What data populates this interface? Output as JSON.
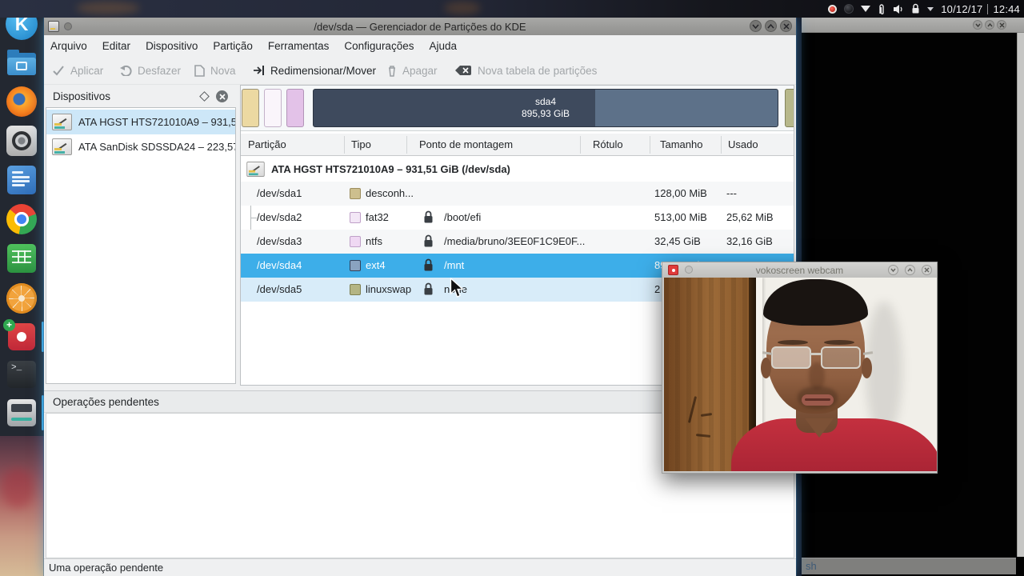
{
  "taskbar": {
    "clock_date": "10/12/17",
    "clock_time": "12:44",
    "tray_icons": [
      "record-icon",
      "dark-sphere-icon",
      "network-triangle-icon",
      "clipboard-paperclip-icon",
      "volume-icon",
      "lock-icon",
      "expand-caret-icon"
    ]
  },
  "dock": {
    "items": [
      {
        "icon": "kde-launcher-icon"
      },
      {
        "icon": "file-manager-icon"
      },
      {
        "icon": "firefox-icon"
      },
      {
        "icon": "media-wheel-icon"
      },
      {
        "icon": "word-processor-icon"
      },
      {
        "icon": "chrome-icon"
      },
      {
        "icon": "spreadsheet-icon"
      },
      {
        "icon": "orange-music-icon"
      },
      {
        "icon": "vokoscreen-icon"
      },
      {
        "icon": "terminal-icon"
      },
      {
        "icon": "partition-manager-icon"
      },
      {
        "icon": "desktop-folder-icon"
      }
    ],
    "kde_letter": "K",
    "terminal_glyph": ">_"
  },
  "background_window": {
    "status_text": "sh"
  },
  "partition_manager": {
    "titlebar": {
      "title": "/dev/sda — Gerenciador de Partições do KDE"
    },
    "menu": {
      "items": [
        {
          "label": "Arquivo"
        },
        {
          "label": "Editar"
        },
        {
          "label": "Dispositivo"
        },
        {
          "label": "Partição"
        },
        {
          "label": "Ferramentas"
        },
        {
          "label": "Configurações"
        },
        {
          "label": "Ajuda"
        }
      ]
    },
    "toolbar": {
      "buttons": [
        {
          "label": "Aplicar",
          "enabled": false,
          "icon": "check-icon"
        },
        {
          "label": "Desfazer",
          "enabled": false,
          "icon": "undo-icon"
        },
        {
          "label": "Nova",
          "enabled": false,
          "icon": "new-document-icon"
        },
        {
          "label": "Redimensionar/Mover",
          "enabled": true,
          "icon": "resize-move-icon"
        },
        {
          "label": "Apagar",
          "enabled": false,
          "icon": "trash-icon"
        },
        {
          "label": "Nova tabela de partições",
          "enabled": false,
          "icon": "backspace-erase-icon"
        }
      ]
    },
    "devices": {
      "title": "Dispositivos",
      "items": [
        {
          "label": "ATA HGST HTS721010A9 – 931,5...",
          "selected": true
        },
        {
          "label": "ATA SanDisk SDSSDA24 – 223,57...",
          "selected": false
        }
      ]
    },
    "partition_bar": {
      "selected": {
        "name": "sda4",
        "size": "895,93 GiB"
      },
      "segment_colors": {
        "sda1": "#ecd9a2",
        "sda2": "#faf5fb",
        "sda3": "#e3c2e8",
        "sda4_used": "#3e4a5d",
        "sda4_free": "#5d7189",
        "sda5": "#b7b88b"
      }
    },
    "table": {
      "columns": [
        {
          "label": "Partição"
        },
        {
          "label": "Tipo"
        },
        {
          "label": "Ponto de montagem"
        },
        {
          "label": "Rótulo"
        },
        {
          "label": "Tamanho"
        },
        {
          "label": "Usado"
        }
      ],
      "root": {
        "label": "ATA HGST HTS721010A9 – 931,51 GiB (/dev/sda)"
      },
      "rows": [
        {
          "partition": "/dev/sda1",
          "type": "desconh...",
          "mount": "",
          "label": "",
          "size": "128,00 MiB",
          "used": "---",
          "swatch": "#cdbf8e",
          "locked": false
        },
        {
          "partition": "/dev/sda2",
          "type": "fat32",
          "mount": "/boot/efi",
          "label": "",
          "size": "513,00 MiB",
          "used": "25,62 MiB",
          "swatch": "#f3e7f6",
          "locked": true
        },
        {
          "partition": "/dev/sda3",
          "type": "ntfs",
          "mount": "/media/bruno/3EE0F1C9E0F...",
          "label": "",
          "size": "32,45 GiB",
          "used": "32,16 GiB",
          "swatch": "#efd8f3",
          "locked": true
        },
        {
          "partition": "/dev/sda4",
          "type": "ext4",
          "mount": "/mnt",
          "label": "",
          "size": "895,93 GiB",
          "used": "",
          "swatch": "#8aa3c0",
          "locked": true,
          "selected": true
        },
        {
          "partition": "/dev/sda5",
          "type": "linuxswap",
          "mount": "none",
          "label": "",
          "size": "2",
          "used": "",
          "swatch": "#b4b584",
          "locked": true,
          "hovered": true
        }
      ],
      "selection_color": "#3daee9"
    },
    "pending_operations": {
      "title": "Operações pendentes"
    },
    "statusbar": {
      "text": "Uma operação pendente"
    }
  },
  "webcam_window": {
    "title": "vokoscreen webcam"
  }
}
